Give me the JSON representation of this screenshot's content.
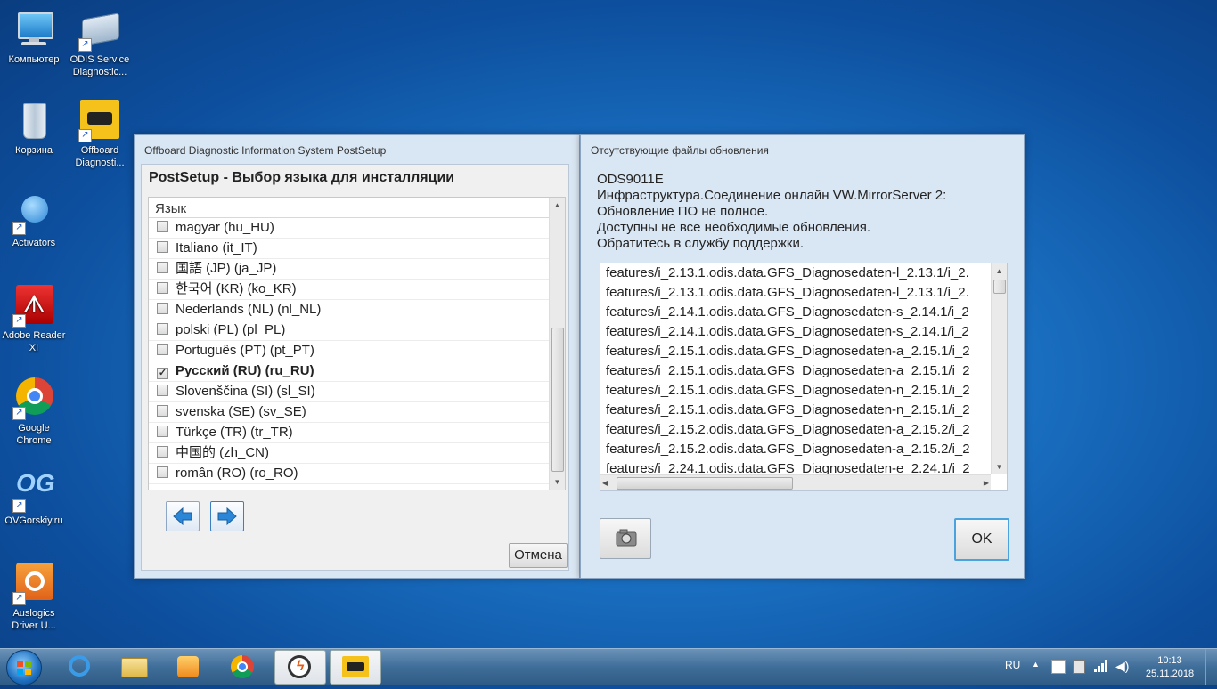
{
  "desktop": {
    "icons": [
      {
        "label": "Компьютер"
      },
      {
        "label": "ODIS Service Diagnostic..."
      },
      {
        "label": "Корзина"
      },
      {
        "label": "Offboard Diagnosti..."
      },
      {
        "label": "Activators"
      },
      {
        "label": "Adobe Reader XI"
      },
      {
        "label": "Google Chrome"
      },
      {
        "label": "OVGorskiy.ru"
      },
      {
        "label": "Auslogics Driver U..."
      }
    ]
  },
  "postsetup": {
    "title": "Offboard Diagnostic Information System PostSetup",
    "heading": "PostSetup - Выбор языка для инсталляции",
    "column_header": "Язык",
    "languages": [
      {
        "label": "magyar  (hu_HU)",
        "checked": false
      },
      {
        "label": "Italiano  (it_IT)",
        "checked": false
      },
      {
        "label": "国語 (JP)  (ja_JP)",
        "checked": false
      },
      {
        "label": "한국어 (KR)  (ko_KR)",
        "checked": false
      },
      {
        "label": "Nederlands (NL)  (nl_NL)",
        "checked": false
      },
      {
        "label": "polski (PL)  (pl_PL)",
        "checked": false
      },
      {
        "label": "Português (PT)  (pt_PT)",
        "checked": false
      },
      {
        "label": "Русский (RU)  (ru_RU)",
        "checked": true
      },
      {
        "label": "Slovenščina (SI)  (sl_SI)",
        "checked": false
      },
      {
        "label": "svenska (SE)  (sv_SE)",
        "checked": false
      },
      {
        "label": "Türkçe (TR)  (tr_TR)",
        "checked": false
      },
      {
        "label": "中国的  (zh_CN)",
        "checked": false
      },
      {
        "label": "român (RO)  (ro_RO)",
        "checked": false
      }
    ],
    "cancel_label": "Отмена"
  },
  "missing_updates": {
    "title": "Отсутствующие файлы обновления",
    "message_lines": [
      "ODS9011E",
      "Инфраструктура.Соединение онлайн VW.MirrorServer 2:",
      "Обновление ПО не полное.",
      "Доступны не все необходимые обновления.",
      "Обратитесь в службу поддержки."
    ],
    "files": [
      "features/i_2.13.1.odis.data.GFS_Diagnosedaten-l_2.13.1/i_2.",
      "features/i_2.13.1.odis.data.GFS_Diagnosedaten-l_2.13.1/i_2.",
      "features/i_2.14.1.odis.data.GFS_Diagnosedaten-s_2.14.1/i_2",
      "features/i_2.14.1.odis.data.GFS_Diagnosedaten-s_2.14.1/i_2",
      "features/i_2.15.1.odis.data.GFS_Diagnosedaten-a_2.15.1/i_2",
      "features/i_2.15.1.odis.data.GFS_Diagnosedaten-a_2.15.1/i_2",
      "features/i_2.15.1.odis.data.GFS_Diagnosedaten-n_2.15.1/i_2",
      "features/i_2.15.1.odis.data.GFS_Diagnosedaten-n_2.15.1/i_2",
      "features/i_2.15.2.odis.data.GFS_Diagnosedaten-a_2.15.2/i_2",
      "features/i_2.15.2.odis.data.GFS_Diagnosedaten-a_2.15.2/i_2",
      "features/i_2.24.1.odis.data.GFS_Diagnosedaten-e_2.24.1/i_2"
    ],
    "ok_label": "OK"
  },
  "taskbar": {
    "language": "RU",
    "time": "10:13",
    "date": "25.11.2018"
  },
  "colors": {
    "accent": "#1f78d1",
    "window_bg": "#d9e6f3"
  }
}
